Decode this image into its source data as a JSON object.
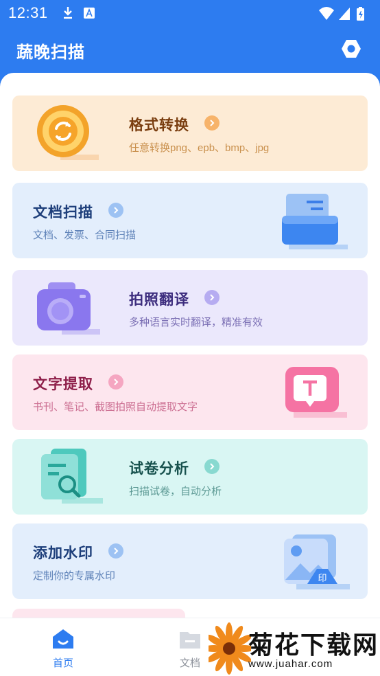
{
  "status_bar": {
    "time": "12:31"
  },
  "header": {
    "title": "蔬晚扫描"
  },
  "cards": [
    {
      "title": "格式转换",
      "subtitle": "任意转换png、epb、bmp、jpg",
      "bg": "#fdebd5",
      "title_color": "#7a3e10",
      "sub_color": "#c9904d",
      "chev_color": "#f7b36a"
    },
    {
      "title": "文档扫描",
      "subtitle": "文档、发票、合同扫描",
      "bg": "#e3eefc",
      "title_color": "#1d3e7a",
      "sub_color": "#5e82b8",
      "chev_color": "#9dc2f3"
    },
    {
      "title": "拍照翻译",
      "subtitle": "多种语言实时翻译，精准有效",
      "bg": "#ebe8fc",
      "title_color": "#3c2c7d",
      "sub_color": "#7b6fb4",
      "chev_color": "#b6acf1"
    },
    {
      "title": "文字提取",
      "subtitle": "书刊、笔记、截图拍照自动提取文字",
      "bg": "#fde6ee",
      "title_color": "#8e1f4a",
      "sub_color": "#cc6f92",
      "chev_color": "#f5a6c1"
    },
    {
      "title": "试卷分析",
      "subtitle": "扫描试卷，自动分析",
      "bg": "#d9f6f3",
      "title_color": "#17514d",
      "sub_color": "#5b9893",
      "chev_color": "#88d9d0"
    },
    {
      "title": "添加水印",
      "subtitle": "定制你的专属水印",
      "bg": "#e3eefc",
      "title_color": "#1d3e7a",
      "sub_color": "#5e82b8",
      "chev_color": "#9dc2f3"
    }
  ],
  "bottom_nav": {
    "home_label": "首页",
    "docs_label": "文档",
    "active_color": "#2d7cf0"
  },
  "watermark": {
    "text": "菊花下载网",
    "url": "www.juahar.com"
  }
}
